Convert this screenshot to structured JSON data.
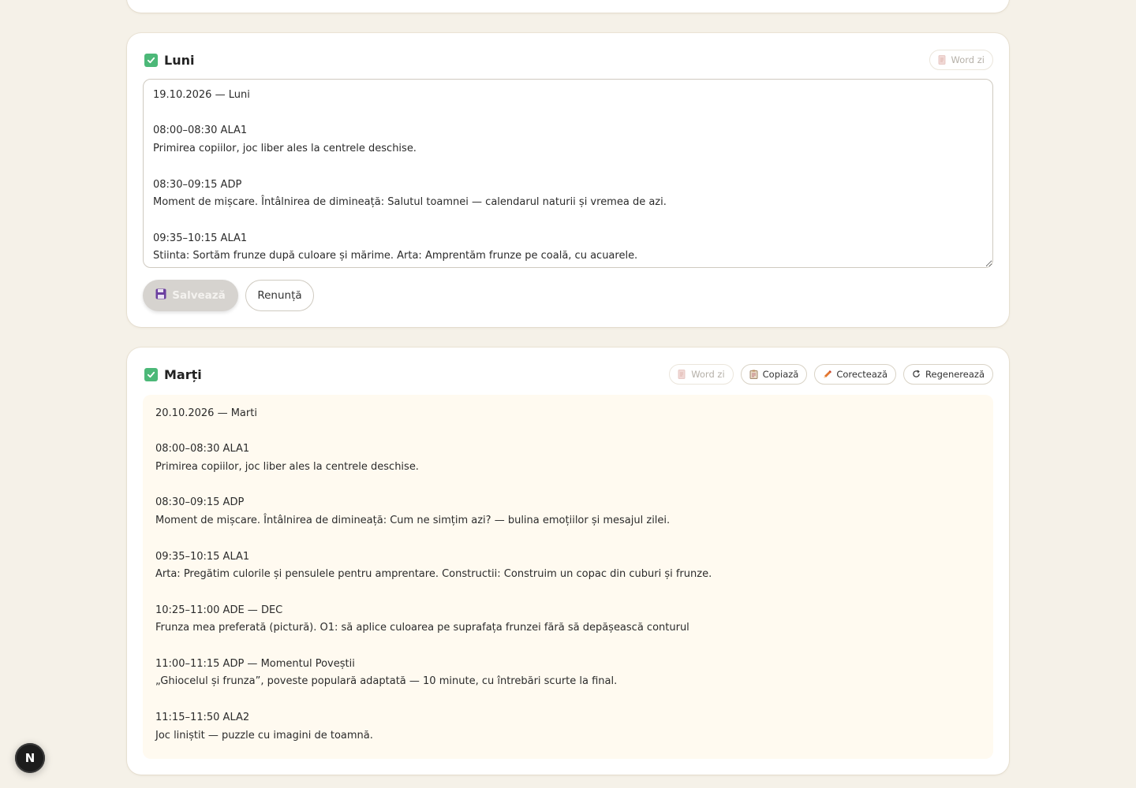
{
  "days": [
    {
      "title": "Luni",
      "word_label": "Word zi",
      "editor_text": "19.10.2026 — Luni\n\n08:00–08:30 ALA1\nPrimirea copiilor, joc liber ales la centrele deschise.\n\n08:30–09:15 ADP\nMoment de mișcare. Întâlnirea de dimineață: Salutul toamnei — calendarul naturii și vremea de azi.\n\n09:35–10:15 ALA1\nStiinta: Sortăm frunze după culoare și mărime. Arta: Amprentăm frunze pe coală, cu acuarele.",
      "save_label": "Salvează",
      "cancel_label": "Renunță"
    },
    {
      "title": "Marți",
      "word_label": "Word zi",
      "copy_label": "Copiază",
      "correct_label": "Corectează",
      "regenerate_label": "Regenerează",
      "lines": [
        "20.10.2026 — Marti",
        "",
        "08:00–08:30 ALA1",
        "Primirea copiilor, joc liber ales la centrele deschise.",
        "",
        "08:30–09:15 ADP",
        "Moment de mișcare. Întâlnirea de dimineață: Cum ne simțim azi? — bulina emoțiilor și mesajul zilei.",
        "",
        "09:35–10:15 ALA1",
        "Arta: Pregătim culorile și pensulele pentru amprentare. Constructii: Construim un copac din cuburi și frunze.",
        "",
        "10:25–11:00 ADE — DEC",
        "Frunza mea preferată (pictură). O1: să aplice culoarea pe suprafața frunzei fără să depășească conturul",
        "",
        "11:00–11:15 ADP — Momentul Poveștii",
        "„Ghiocelul și frunza”, poveste populară adaptată — 10 minute, cu întrebări scurte la final.",
        "",
        "11:15–11:50 ALA2",
        "Joc liniștit — puzzle cu imagini de toamnă."
      ]
    }
  ],
  "badge_letter": "N",
  "icons": {
    "check": "check-icon",
    "word": "document-icon",
    "copy": "clipboard-icon",
    "correct": "pencil-icon",
    "regenerate": "refresh-icon",
    "save": "floppy-disk-icon"
  },
  "colors": {
    "background": "#f5f1e8",
    "check_green": "#4cb878",
    "content_bg": "#fffaf0",
    "save_disabled": "#d6d3cf"
  }
}
